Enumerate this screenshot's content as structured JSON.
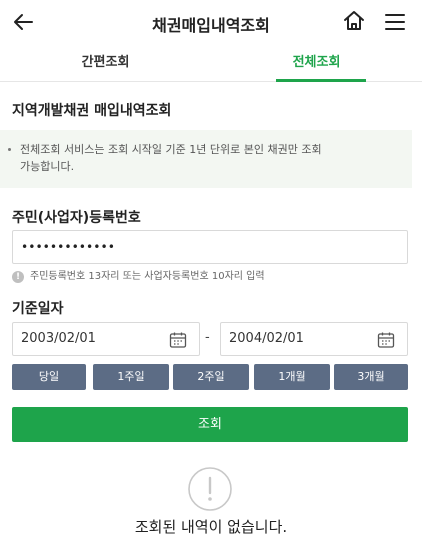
{
  "header": {
    "title": "채권매입내역조회"
  },
  "tabs": [
    {
      "label": "간편조회",
      "active": false
    },
    {
      "label": "전체조회",
      "active": true
    }
  ],
  "section_title": "지역개발채권 매입내역조회",
  "notice": {
    "line1": "전체조회 서비스는 조회 시작일 기준 1년 단위로 본인 채권만 조회",
    "line2": "가능합니다."
  },
  "id_field": {
    "label": "주민(사업자)등록번호",
    "value": "•••••••••••••",
    "hint": "주민등록번호 13자리 또는 사업자등록번호 10자리 입력"
  },
  "date": {
    "label": "기준일자",
    "start": "2003/02/01",
    "separator": "-",
    "end": "2004/02/01"
  },
  "quick_buttons": [
    "당일",
    "1주일",
    "2주일",
    "1개월",
    "3개월"
  ],
  "search_button": "조회",
  "empty_message": "조회된 내역이 없습니다.",
  "colors": {
    "accent": "#1ea44b",
    "quick_button": "#5c6c85",
    "notice_bg": "#f3f7f2"
  },
  "icons": {
    "back": "arrow-left-icon",
    "home": "home-icon",
    "menu": "hamburger-menu-icon",
    "calendar": "calendar-icon",
    "info": "info-circle-icon",
    "empty": "exclamation-circle-icon"
  }
}
